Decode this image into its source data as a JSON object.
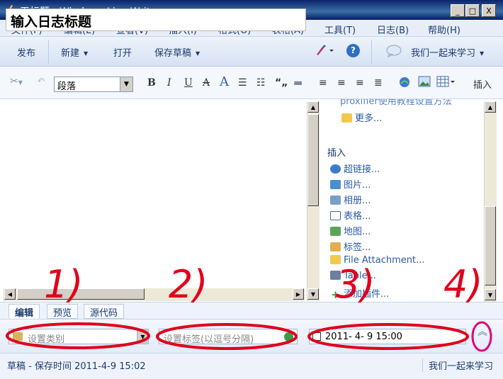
{
  "window": {
    "title": "无标题 - Windows Live Writer",
    "controls": [
      "_",
      "□",
      "X"
    ]
  },
  "menu": [
    "文件(F)",
    "编辑(E)",
    "查看(V)",
    "插入(I)",
    "格式(O)",
    "表格(A)",
    "工具(T)",
    "日志(B)",
    "帮助(H)"
  ],
  "toolbar": {
    "publish": "发布",
    "new": "新建",
    "open": "打开",
    "save_draft": "保存草稿",
    "help": "?",
    "account": "我们一起来学习"
  },
  "format": {
    "paragraph": "段落",
    "bold": "B",
    "italic": "I",
    "underline": "U",
    "strike": "A",
    "font_color": "A",
    "quote": "“„",
    "insert": "插入"
  },
  "editor": {
    "title_placeholder": "输入日志标题"
  },
  "sidebar": {
    "top_partial": "proxifier使用教程设置方法",
    "more": "更多...",
    "insert_heading": "插入",
    "items": [
      "超链接...",
      "图片...",
      "相册...",
      "表格...",
      "地图...",
      "标签...",
      "File Attachment...",
      "Table...",
      "添加插件..."
    ]
  },
  "tabs": [
    "编辑",
    "预览",
    "源代码"
  ],
  "props": {
    "category_placeholder": "设置类别",
    "tags_placeholder": "设置标签(以逗号分隔)",
    "datetime": "2011-  4-  9 15:00"
  },
  "status": {
    "left": "草稿 - 保存时间 2011-4-9 15:02",
    "right": "我们一起来学习"
  },
  "annotations": [
    "1)",
    "2)",
    "3)",
    "4)"
  ],
  "colors": {
    "annotation_red": "#e0001c",
    "annotation_magenta": "#e0007a",
    "titlebar": "#0a246a"
  }
}
